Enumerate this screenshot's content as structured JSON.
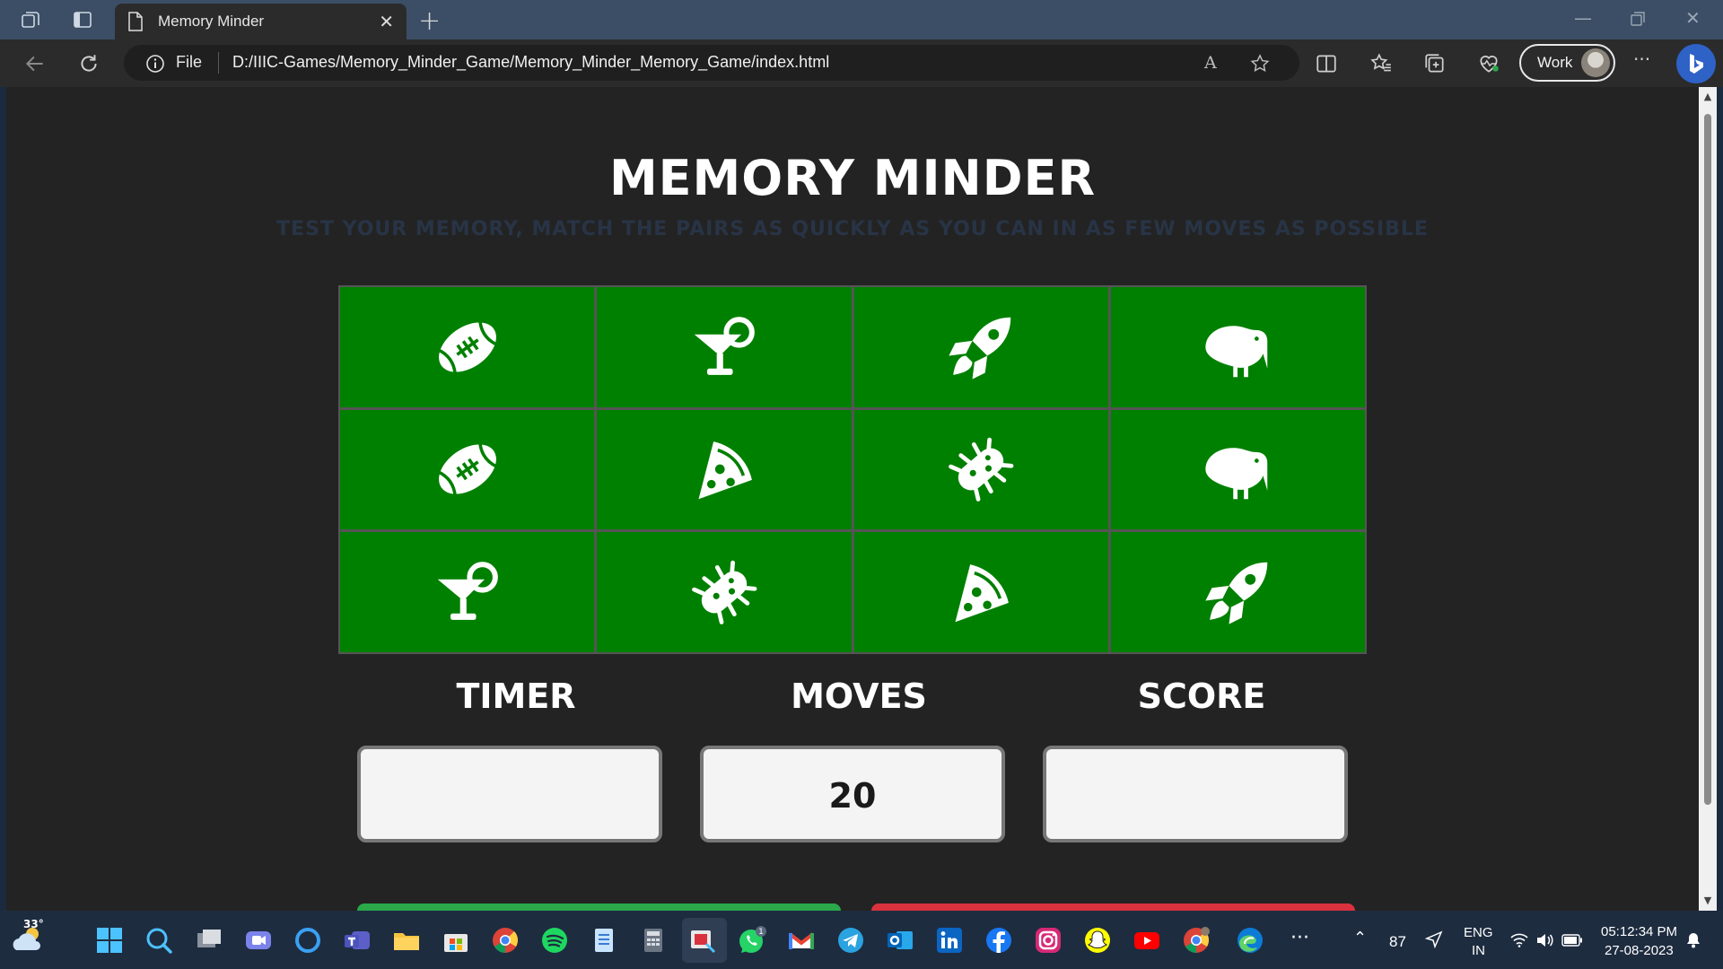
{
  "browser": {
    "tab_title": "Memory Minder",
    "tab_close": "✕",
    "new_tab": "+",
    "file_label": "File",
    "url": "D:/IIIC-Games/Memory_Minder_Game/Memory_Minder_Memory_Game/index.html",
    "read_aloud": "A",
    "profile_label": "Work",
    "more": "···"
  },
  "page": {
    "title": "MEMORY MINDER",
    "subtitle": "TEST YOUR MEMORY, MATCH THE PAIRS AS QUICKLY AS YOU CAN IN AS FEW MOVES AS POSSIBLE",
    "cards": [
      {
        "icon": "football-icon"
      },
      {
        "icon": "cocktail-icon"
      },
      {
        "icon": "rocket-icon"
      },
      {
        "icon": "kiwi-bird-icon"
      },
      {
        "icon": "football-icon"
      },
      {
        "icon": "pizza-slice-icon"
      },
      {
        "icon": "bacterium-icon"
      },
      {
        "icon": "kiwi-bird-icon"
      },
      {
        "icon": "cocktail-icon"
      },
      {
        "icon": "bacterium-icon"
      },
      {
        "icon": "pizza-slice-icon"
      },
      {
        "icon": "rocket-icon"
      }
    ],
    "card_color": "#008000",
    "timer_label": "TIMER",
    "timer_value": "",
    "moves_label": "MOVES",
    "moves_value": "20",
    "score_label": "SCORE",
    "score_value": ""
  },
  "taskbar": {
    "weather_temp": "33°",
    "whatsapp_badge": "1",
    "battery": "87",
    "lang_line1": "ENG",
    "lang_line2": "IN",
    "time": "05:12:34 PM",
    "date": "27-08-2023"
  }
}
